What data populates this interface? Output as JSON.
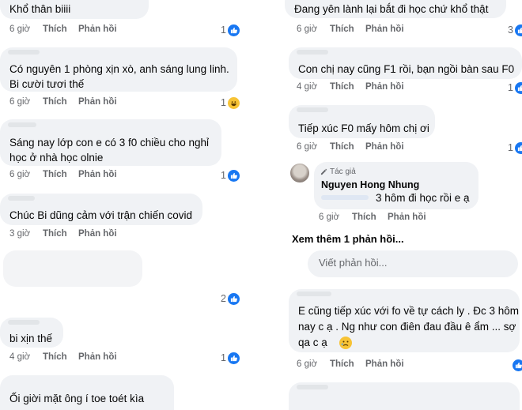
{
  "colors": {
    "bubble_bg": "#f0f2f5",
    "like_blue": "#1877f2",
    "meta_gray": "#65676b",
    "text": "#050505"
  },
  "left_comments": [
    {
      "text_lines": [
        "Khổ thân biiii"
      ],
      "time": "6 giờ",
      "like": "Thích",
      "reply": "Phản hồi",
      "reaction_count": "1",
      "reaction_icon": "like-icon"
    },
    {
      "text_lines": [
        "Có nguyên 1 phòng xịn xò, anh sáng lung linh.",
        "Bi cười tươi thế"
      ],
      "time": "6 giờ",
      "like": "Thích",
      "reply": "Phản hồi",
      "reaction_count": "1",
      "reaction_icon": "haha-icon"
    },
    {
      "text_lines": [
        "Sáng nay lớp con e có 3 f0   chiều cho nghỉ",
        "học ở nhà học olnie"
      ],
      "time": "6 giờ",
      "like": "Thích",
      "reply": "Phản hồi",
      "reaction_count": "1",
      "reaction_icon": "like-icon"
    },
    {
      "text_lines": [
        "Chúc Bi dũng cảm với trận chiến covid"
      ],
      "time": "3 giờ",
      "like": "Thích",
      "reply": "Phản hồi",
      "reaction_count": "",
      "reaction_icon": ""
    },
    {
      "text_lines": [],
      "time": "",
      "like": "",
      "reply": "",
      "reaction_count": "2",
      "reaction_icon": "like-icon"
    },
    {
      "text_lines": [
        "bi xịn thế"
      ],
      "time": "4 giờ",
      "like": "Thích",
      "reply": "Phản hồi",
      "reaction_count": "1",
      "reaction_icon": "like-icon"
    },
    {
      "text_lines": [
        "Ối giời mặt ông í toe toét kìa"
      ],
      "time": "",
      "like": "",
      "reply": "",
      "reaction_count": "",
      "reaction_icon": ""
    }
  ],
  "right_comments": [
    {
      "text_lines": [
        "Đang yên lành lại bắt đi học chứ khổ thật"
      ],
      "time": "6 giờ",
      "like": "Thích",
      "reply": "Phản hồi",
      "reaction_count": "3",
      "reaction_icon": "like-icon"
    },
    {
      "text_lines": [
        "Con chị nay cũng F1 rồi, bạn ngồi bàn sau F0"
      ],
      "time": "4 giờ",
      "like": "Thích",
      "reply": "Phản hồi",
      "reaction_count": "1",
      "reaction_icon": "like-icon"
    },
    {
      "text_lines": [
        "Tiếp xúc F0 mấy hôm chị ơi"
      ],
      "time": "6 giờ",
      "like": "Thích",
      "reply": "Phản hồi",
      "reaction_count": "1",
      "reaction_icon": "like-icon"
    },
    {
      "text_lines": [
        "E cũng tiếp xúc với fo về tự cách ly . Đc 3 hôm",
        "nay c ạ . Ng như con điên đau đầu ê ẩm ... sợ",
        "qa c ạ"
      ],
      "time": "6 giờ",
      "like": "Thích",
      "reply": "Phản hồi",
      "reaction_count": "",
      "reaction_icon": "sad-icon"
    }
  ],
  "author_reply": {
    "badge": "Tác giả",
    "name": "Nguyen Hong Nhung",
    "text": "3 hôm đi học rồi e ạ",
    "time": "6 giờ",
    "like": "Thích",
    "reply": "Phản hồi"
  },
  "see_more": "Xem thêm 1 phản hồi...",
  "reply_placeholder": "Viết phản hồi..."
}
